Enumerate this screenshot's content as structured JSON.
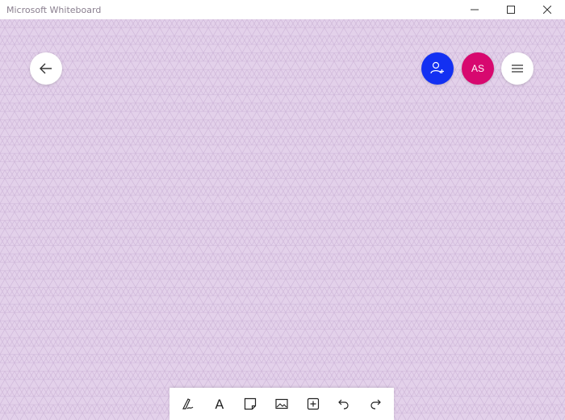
{
  "window": {
    "title": "Microsoft Whiteboard",
    "controls": [
      "minimize-icon",
      "maximize-icon",
      "close-icon"
    ]
  },
  "canvas": {
    "background": "#e3d1ea",
    "grid": "triangle",
    "grid_color": "#cdb5d8"
  },
  "header": {
    "back_icon": "arrow-left-icon",
    "invite_icon": "add-person-icon",
    "avatar_initials": "AS",
    "menu_icon": "hamburger-icon",
    "colors": {
      "invite": "#1330f2",
      "avatar": "#d7086f"
    }
  },
  "toolbar": {
    "tools": [
      {
        "name": "pen-icon"
      },
      {
        "name": "text-tool",
        "label": "A"
      },
      {
        "name": "sticky-note-icon"
      },
      {
        "name": "image-icon"
      },
      {
        "name": "insert-icon"
      },
      {
        "name": "undo-icon"
      },
      {
        "name": "redo-icon"
      }
    ]
  }
}
